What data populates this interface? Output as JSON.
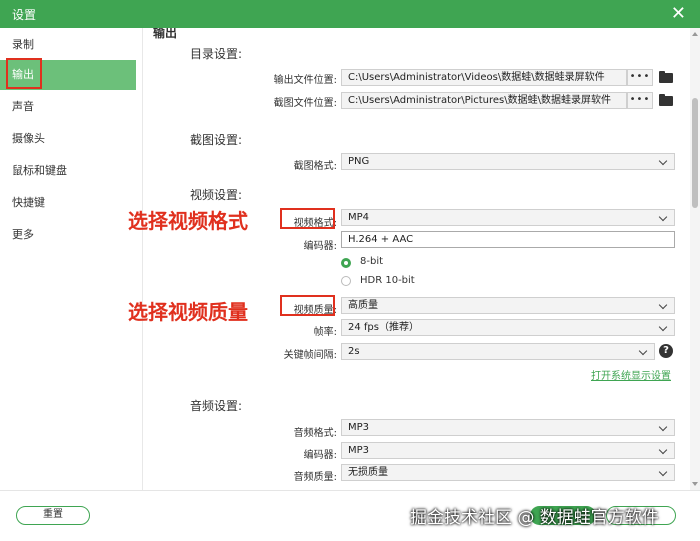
{
  "window": {
    "title": "设置",
    "close_glyph": "✕"
  },
  "sidebar": {
    "items": [
      {
        "label": "录制"
      },
      {
        "label": "输出"
      },
      {
        "label": "声音"
      },
      {
        "label": "摄像头"
      },
      {
        "label": "鼠标和键盘"
      },
      {
        "label": "快捷键"
      },
      {
        "label": "更多"
      }
    ],
    "active_index": 1
  },
  "content": {
    "page_title": "输出",
    "dir_section": {
      "heading": "目录设置:",
      "output_label": "输出文件位置:",
      "output_value": "C:\\Users\\Administrator\\Videos\\数据蛙\\数据蛙录屏软件",
      "screenshot_label": "截图文件位置:",
      "screenshot_value": "C:\\Users\\Administrator\\Pictures\\数据蛙\\数据蛙录屏软件",
      "browse_glyph": "•••"
    },
    "screenshot_section": {
      "heading": "截图设置:",
      "format_label": "截图格式:",
      "format_value": "PNG"
    },
    "video_section": {
      "heading": "视频设置:",
      "format_label": "视频格式:",
      "format_value": "MP4",
      "encoder_label": "编码器:",
      "encoder_value": "H.264 + AAC",
      "bit_options": [
        "8-bit",
        "HDR 10-bit"
      ],
      "bit_selected_index": 0,
      "quality_label": "视频质量:",
      "quality_value": "高质量",
      "fps_label": "帧率:",
      "fps_value": "24 fps（推荐）",
      "keyframe_label": "关键帧间隔:",
      "keyframe_value": "2s",
      "help_glyph": "?",
      "display_settings_link": "打开系统显示设置"
    },
    "audio_section": {
      "heading": "音频设置:",
      "format_label": "音频格式:",
      "format_value": "MP3",
      "encoder_label": "编码器:",
      "encoder_value": "MP3",
      "quality_label": "音频质量:",
      "quality_value": "无损质量"
    }
  },
  "annotations": {
    "select_format": "选择视频格式",
    "select_quality": "选择视频质量"
  },
  "footer": {
    "reset_label": "重置",
    "watermark": "掘金技术社区 @ 数据蛙官方软件"
  },
  "colors": {
    "accent": "#3fa552",
    "sidebar_active": "#6cc07a",
    "annotation_red": "#e0301e"
  }
}
